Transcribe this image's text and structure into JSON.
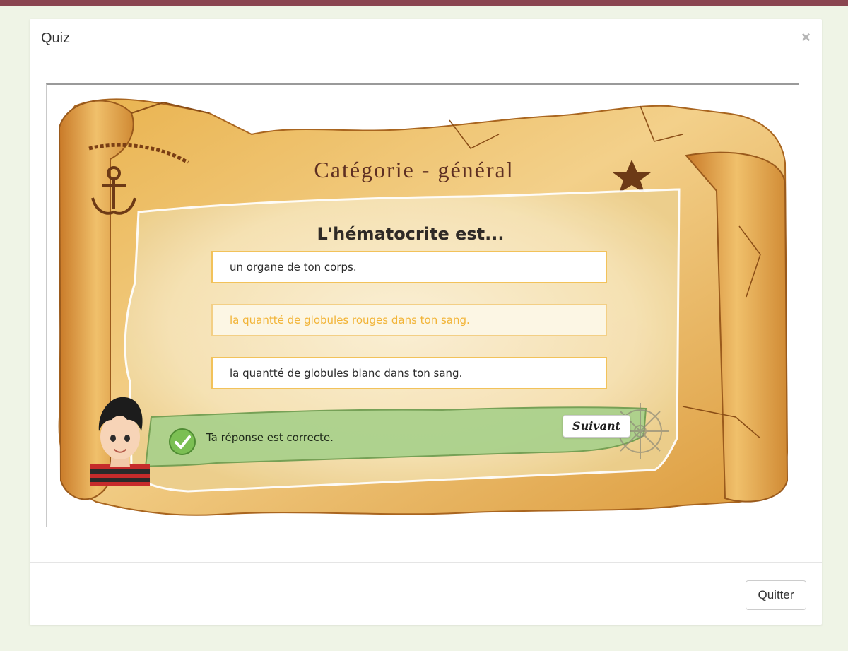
{
  "modal": {
    "title": "Quiz",
    "close_label": "×",
    "quit_label": "Quitter"
  },
  "game": {
    "category": "Catégorie - général",
    "question": "L'hématocrite est...",
    "answers": [
      {
        "text": "un organe de ton corps.",
        "selected": false
      },
      {
        "text": "la quantté de globules rouges dans ton sang.",
        "selected": true
      },
      {
        "text": "la quantté de globules blanc dans ton sang.",
        "selected": false
      }
    ],
    "feedback": "Ta réponse est correcte.",
    "next_label": "Suivant"
  },
  "colors": {
    "top_bar": "#8a4550",
    "page_bg": "#eff4e6",
    "answer_border": "#f2c25a",
    "selected_answer_text": "#f2b437",
    "feedback_banner": "#a9d18b",
    "category_title": "#5e2f22"
  },
  "icons": {
    "close": "close-icon",
    "check": "check-circle-icon",
    "anchor": "anchor-icon",
    "star": "star-icon",
    "helm": "ship-wheel-icon"
  }
}
